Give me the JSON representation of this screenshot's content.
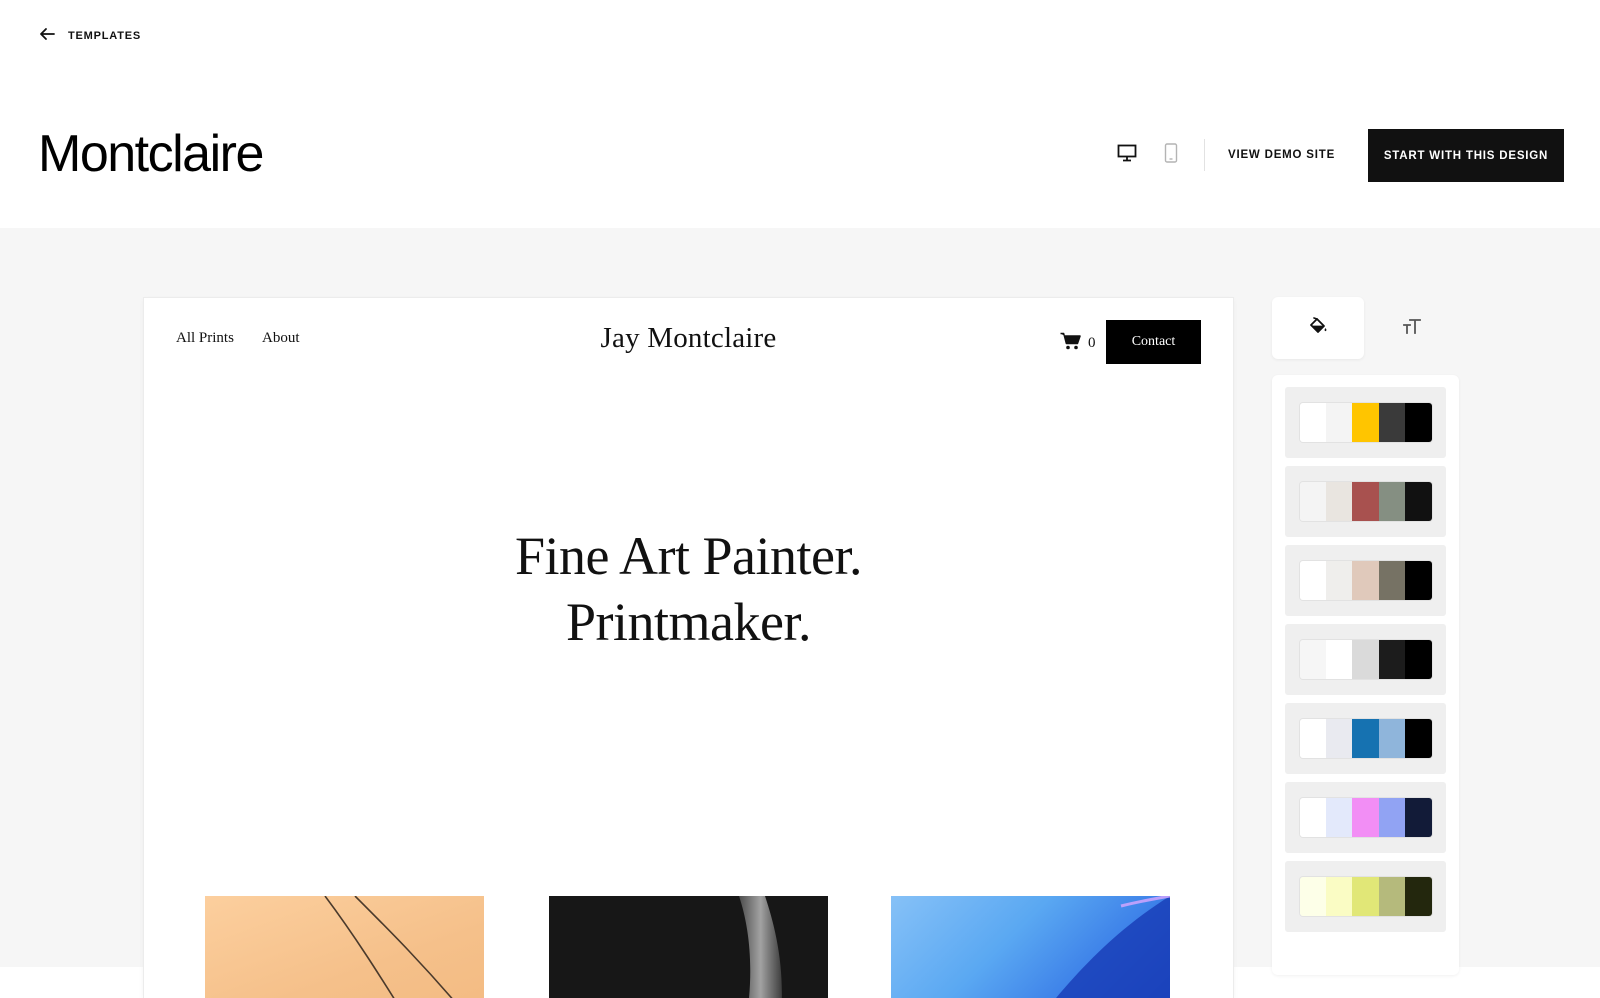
{
  "header": {
    "back_label": "TEMPLATES",
    "template_title": "Montclaire",
    "view_demo_label": "VIEW DEMO SITE",
    "start_label": "START WITH THIS DESIGN",
    "devices": [
      {
        "name": "desktop-icon",
        "active": true
      },
      {
        "name": "mobile-icon",
        "active": false
      }
    ]
  },
  "preview": {
    "nav_links": [
      "All Prints",
      "About"
    ],
    "site_logo": "Jay Montclaire",
    "cart_count": "0",
    "contact_label": "Contact",
    "hero_line1": "Fine Art Painter.",
    "hero_line2": "Printmaker."
  },
  "tools": {
    "tabs": [
      {
        "name": "colors",
        "icon": "paint-bucket-icon",
        "active": true
      },
      {
        "name": "fonts",
        "icon": "text-size-icon",
        "active": false
      }
    ]
  },
  "palettes": [
    [
      "#ffffff",
      "#f4f4f4",
      "#ffc500",
      "#3a3a3a",
      "#000000"
    ],
    [
      "#f4f4f4",
      "#e9e5e0",
      "#a8514f",
      "#858f82",
      "#111111"
    ],
    [
      "#ffffff",
      "#efeeec",
      "#e0c9bb",
      "#767264",
      "#000000"
    ],
    [
      "#f6f6f6",
      "#ffffff",
      "#dadada",
      "#1c1c1c",
      "#000000"
    ],
    [
      "#ffffff",
      "#e9eaf0",
      "#1672b1",
      "#8fb5db",
      "#000000"
    ],
    [
      "#ffffff",
      "#e3e9fb",
      "#f28ef5",
      "#91a3f3",
      "#121b38"
    ],
    [
      "#fdffe8",
      "#fafcc4",
      "#e1e777",
      "#b5ba7c",
      "#23270d"
    ]
  ]
}
